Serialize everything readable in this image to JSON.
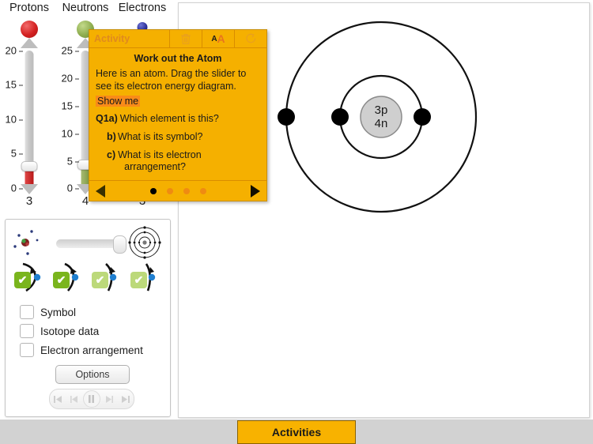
{
  "sliders": [
    {
      "name": "protons",
      "label": "Protons",
      "value": "3",
      "min": 0,
      "max": 20,
      "ticks": [
        "20",
        "15",
        "10",
        "5",
        "0"
      ],
      "ball_color": "#d42121",
      "fill_color": "#b81818"
    },
    {
      "name": "neutrons",
      "label": "Neutrons",
      "value": "4",
      "min": 0,
      "max": 25,
      "ticks": [
        "25",
        "20",
        "15",
        "10",
        "5",
        "0"
      ],
      "ball_color": "#8fae50",
      "fill_color": "#7d9843"
    },
    {
      "name": "electrons",
      "label": "Electrons",
      "value": "3",
      "min": 0,
      "max": 20,
      "ticks": [],
      "ball_color": "#2b2f96",
      "fill_color": "#2b2f96"
    }
  ],
  "activity": {
    "panel_title": "Activity",
    "toolbar": [
      {
        "icon": "trash-icon",
        "label": ""
      },
      {
        "icon": "text-size-icon",
        "label": "AA"
      },
      {
        "icon": "reset-icon",
        "label": ""
      }
    ],
    "title": "Work out the Atom",
    "intro_line1": "Here is an atom. Drag the slider to",
    "intro_line2": "see its electron energy diagram.",
    "show_me": "Show me",
    "questions": [
      {
        "label": "Q1a)",
        "text": "Which element is this?",
        "indent": false
      },
      {
        "label": "b)",
        "text": "What is its symbol?",
        "indent": true
      },
      {
        "label": "c)",
        "text": "What is its electron",
        "text2": "arrangement?",
        "indent": true
      }
    ],
    "prev_label": "◀",
    "next_label": "▶",
    "page_dots": 4,
    "active_dot": 0,
    "accent_color": "#f5b000",
    "highlight_color": "#f98b19"
  },
  "controls": {
    "zoom_slider": {
      "left_icon": "scattered-atom-icon",
      "right_icon": "shell-diagram-icon",
      "position_percent": 88
    },
    "shell_toggles": [
      {
        "checked": true,
        "shade": "dark"
      },
      {
        "checked": true,
        "shade": "dark"
      },
      {
        "checked": true,
        "shade": "light"
      },
      {
        "checked": true,
        "shade": "light"
      }
    ],
    "check_mark": "✔",
    "options": [
      {
        "label": "Symbol",
        "checked": false
      },
      {
        "label": "Isotope data",
        "checked": false
      },
      {
        "label": "Electron arrangement",
        "checked": false
      }
    ],
    "options_button": "Options",
    "playback": [
      {
        "icon": "skip-back-icon",
        "glyph": "◀|"
      },
      {
        "icon": "step-back-icon",
        "glyph": "◀|"
      },
      {
        "icon": "pause-icon",
        "glyph": "❚❚"
      },
      {
        "icon": "step-forward-icon",
        "glyph": "|▶"
      },
      {
        "icon": "skip-forward-icon",
        "glyph": "|▶"
      }
    ]
  },
  "atom": {
    "nucleus_line1": "3p",
    "nucleus_line2": "4n",
    "nucleus_fill": "#cfcfcf",
    "shells": [
      {
        "radius": 52,
        "electrons": 2
      },
      {
        "radius": 120,
        "electrons": 1
      }
    ],
    "electron_color": "#000000"
  },
  "bottom": {
    "activities_label": "Activities",
    "bar_color": "#d2d2d2",
    "button_color": "#f8b200"
  }
}
